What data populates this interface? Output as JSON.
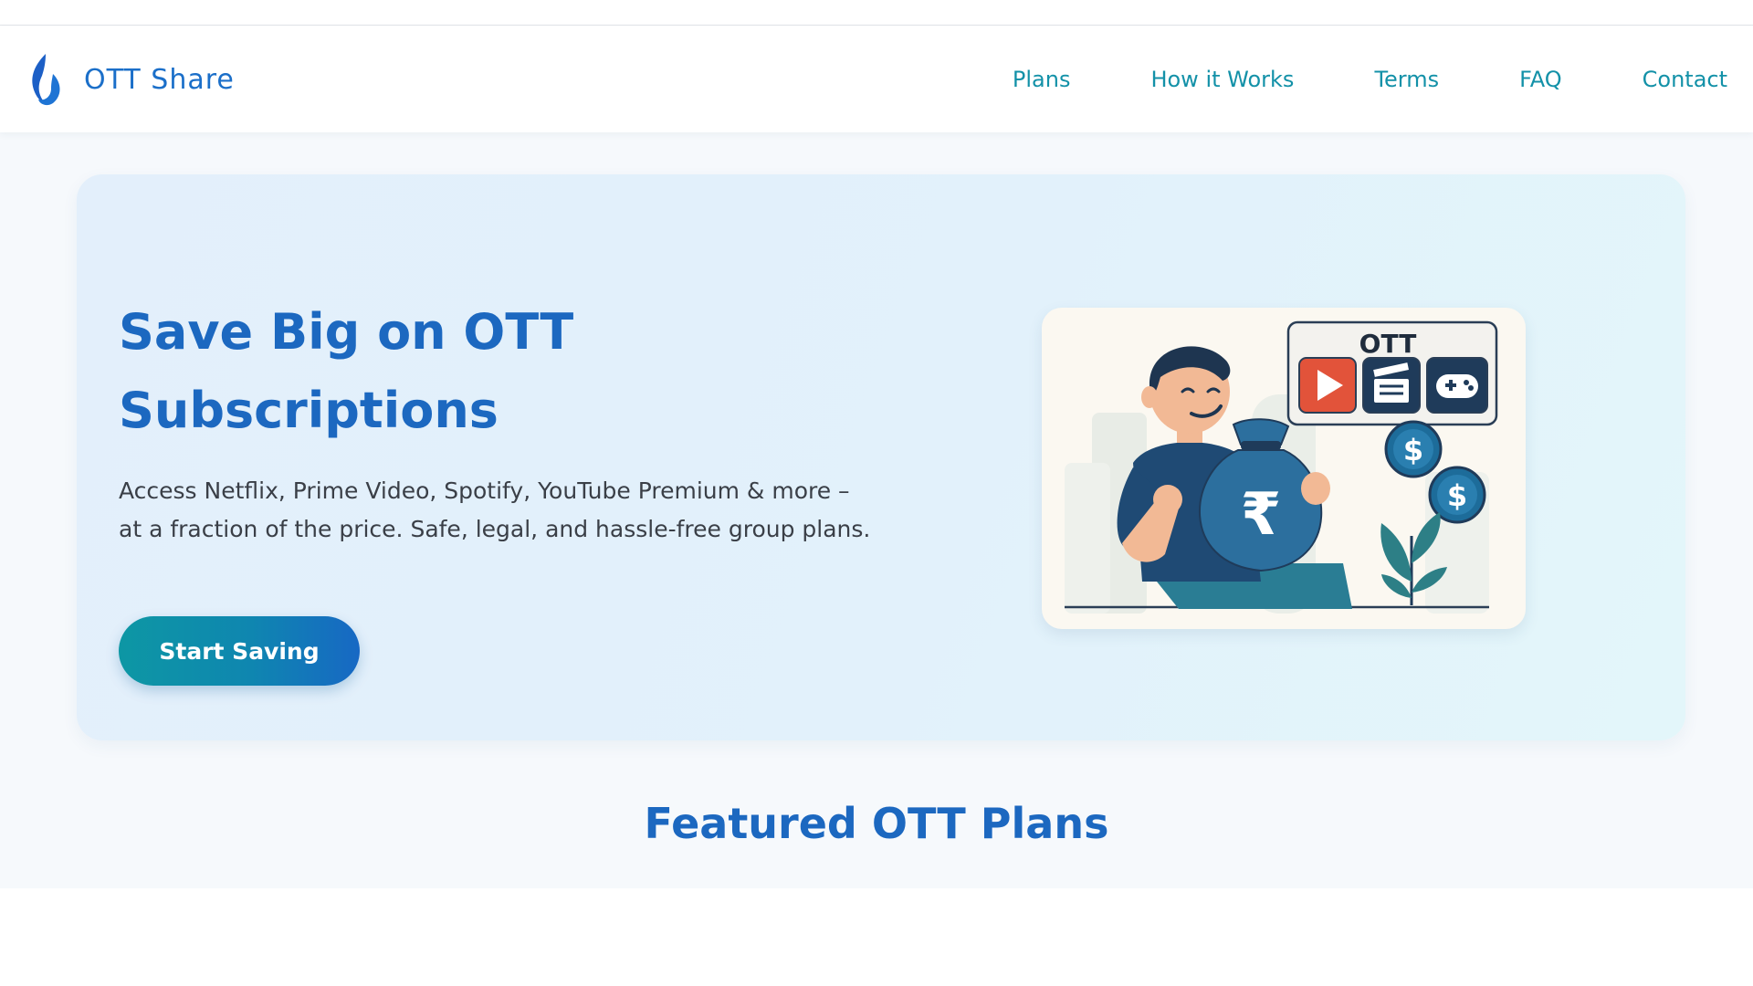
{
  "brand": {
    "name": "OTT Share",
    "logo_icon": "flame-logo-icon",
    "color": "#1b6fc9"
  },
  "nav": {
    "links": [
      "Plans",
      "How it Works",
      "Terms",
      "FAQ",
      "Contact"
    ],
    "color": "#1391a8"
  },
  "hero": {
    "title": "Save Big on OTT Subscriptions",
    "description": "Access Netflix, Prime Video, Spotify, YouTube Premium & more – at a fraction of the price. Safe, legal, and hassle-free group plans.",
    "cta_label": "Start Saving",
    "illustration": {
      "screen_label": "OTT",
      "icons": [
        "play-icon",
        "clapperboard-icon",
        "gamepad-icon"
      ],
      "bag_symbol": "₹",
      "coin_symbol": "$"
    }
  },
  "featured": {
    "title": "Featured OTT Plans"
  },
  "colors": {
    "accent": "#1c68c0",
    "teal": "#1391a8",
    "hero_bg": "#e3effb",
    "page_bg": "#f6f9fc"
  }
}
